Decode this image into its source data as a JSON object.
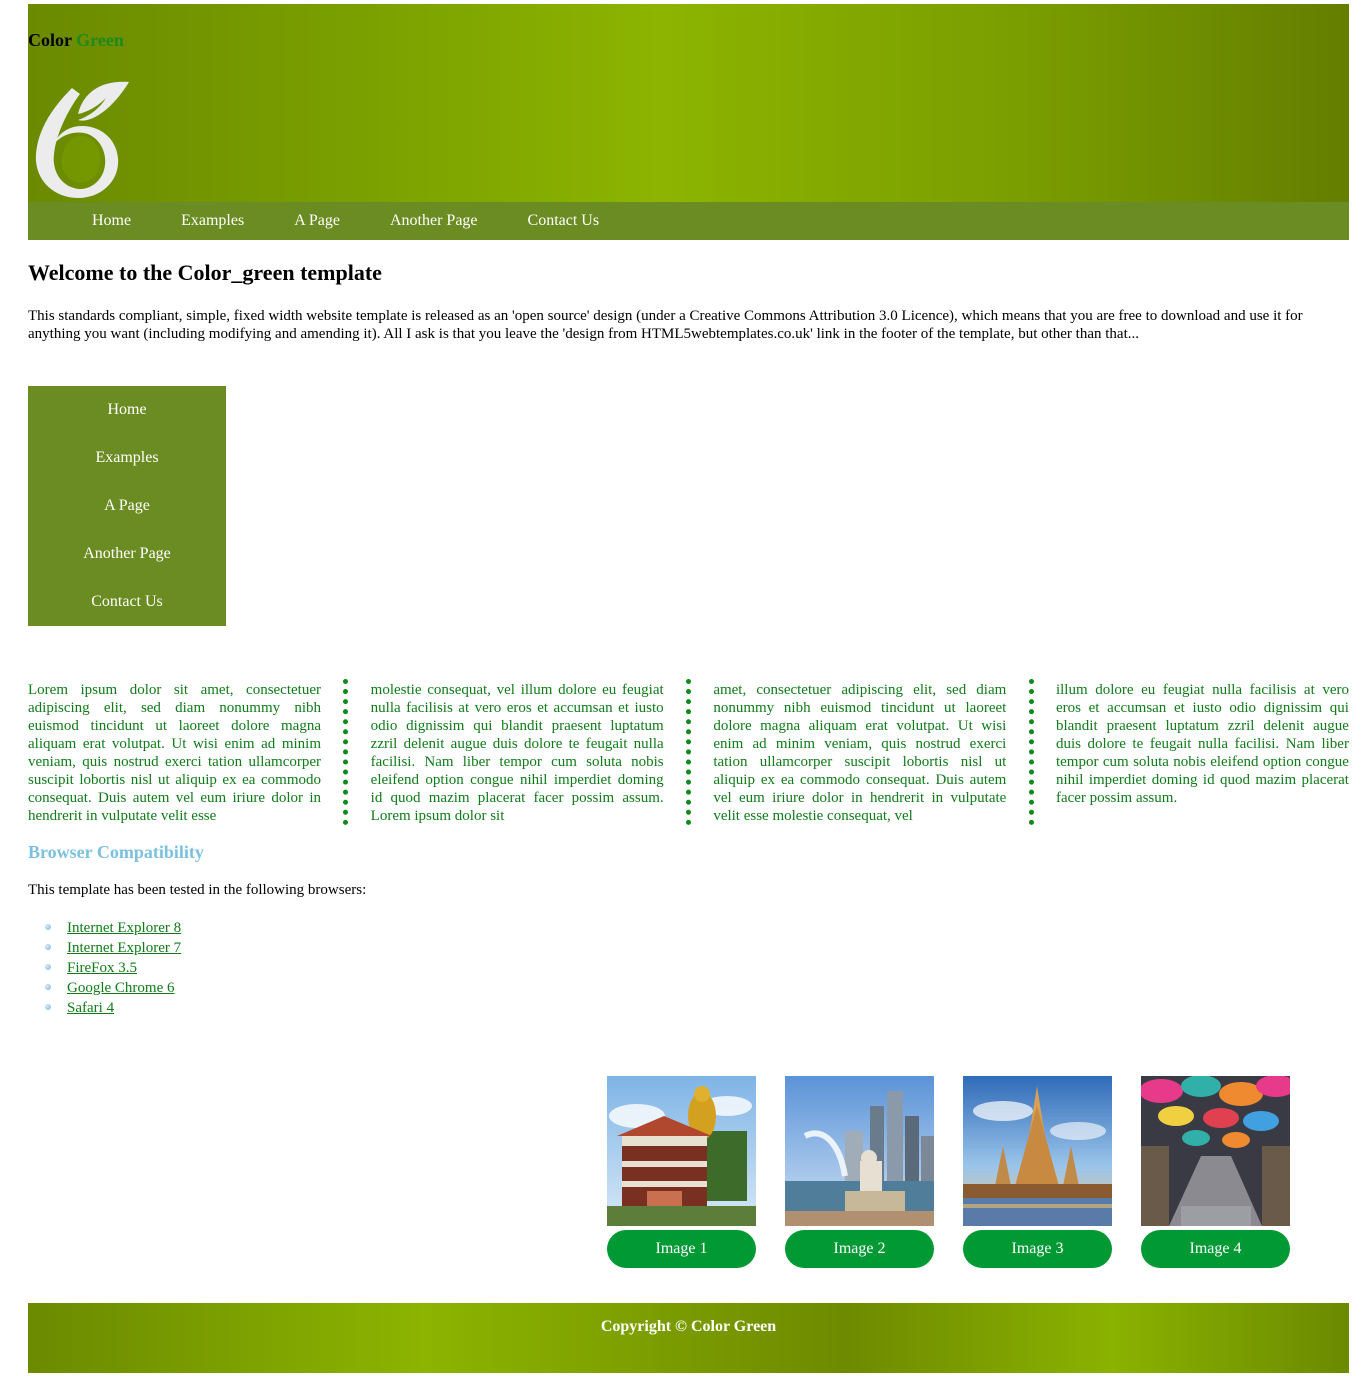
{
  "header": {
    "title_part1": "Color",
    "title_part2": "Green"
  },
  "topnav": [
    "Home",
    "Examples",
    "A Page",
    "Another Page",
    "Contact Us"
  ],
  "welcome": {
    "heading": "Welcome to the Color_green template",
    "text": "This standards compliant, simple, fixed width website template is released as an 'open source' design (under a Creative Commons Attribution 3.0 Licence), which means that you are free to download and use it for anything you want (including modifying and amending it). All I ask is that you leave the 'design from HTML5webtemplates.co.uk' link in the footer of the template, but other than that..."
  },
  "sidenav": [
    "Home",
    "Examples",
    "A Page",
    "Another Page",
    "Contact Us"
  ],
  "columns": [
    "Lorem ipsum dolor sit amet, consectetuer adipiscing elit, sed diam nonummy nibh euismod tincidunt ut laoreet dolore magna aliquam erat volutpat. Ut wisi enim ad minim veniam, quis nostrud exerci tation ullamcorper suscipit lobortis nisl ut aliquip ex ea commodo consequat. Duis autem vel eum iriure dolor in hendrerit in vulputate velit esse",
    "molestie consequat, vel illum dolore eu feugiat nulla facilisis at vero eros et accumsan et iusto odio dignissim qui blandit praesent luptatum zzril delenit augue duis dolore te feugait nulla facilisi. Nam liber tempor cum soluta nobis eleifend option congue nihil imperdiet doming id quod mazim placerat facer possim assum. Lorem ipsum dolor sit",
    "amet, consectetuer adipiscing elit, sed diam nonummy nibh euismod tincidunt ut laoreet dolore magna aliquam erat volutpat. Ut wisi enim ad minim veniam, quis nostrud exerci tation ullamcorper suscipit lobortis nisl ut aliquip ex ea commodo consequat. Duis autem vel eum iriure dolor in hendrerit in vulputate velit esse molestie consequat, vel",
    "illum dolore eu feugiat nulla facilisis at vero eros et accumsan et iusto odio dignissim qui blandit praesent luptatum zzril delenit augue duis dolore te feugait nulla facilisi. Nam liber tempor cum soluta nobis eleifend option congue nihil imperdiet doming id quod mazim placerat facer possim assum."
  ],
  "compat": {
    "heading": "Browser Compatibility",
    "text": "This template has been tested in the following browsers:",
    "browsers": [
      "Internet Explorer 8",
      "Internet Explorer 7",
      "FireFox 3.5",
      "Google Chrome 6",
      "Safari 4"
    ]
  },
  "gallery": [
    {
      "label": "Image 1",
      "icon": "temple-photo"
    },
    {
      "label": "Image 2",
      "icon": "merlion-city-photo"
    },
    {
      "label": "Image 3",
      "icon": "pagoda-photo"
    },
    {
      "label": "Image 4",
      "icon": "umbrella-street-photo"
    }
  ],
  "footer": {
    "copyright": "Copyright © Color Green"
  },
  "colors": {
    "header_green": "#8cb400",
    "nav_green": "#6b8c22",
    "text_green": "#117a1a",
    "button_green": "#009933",
    "compat_heading": "#7cc0e0"
  }
}
